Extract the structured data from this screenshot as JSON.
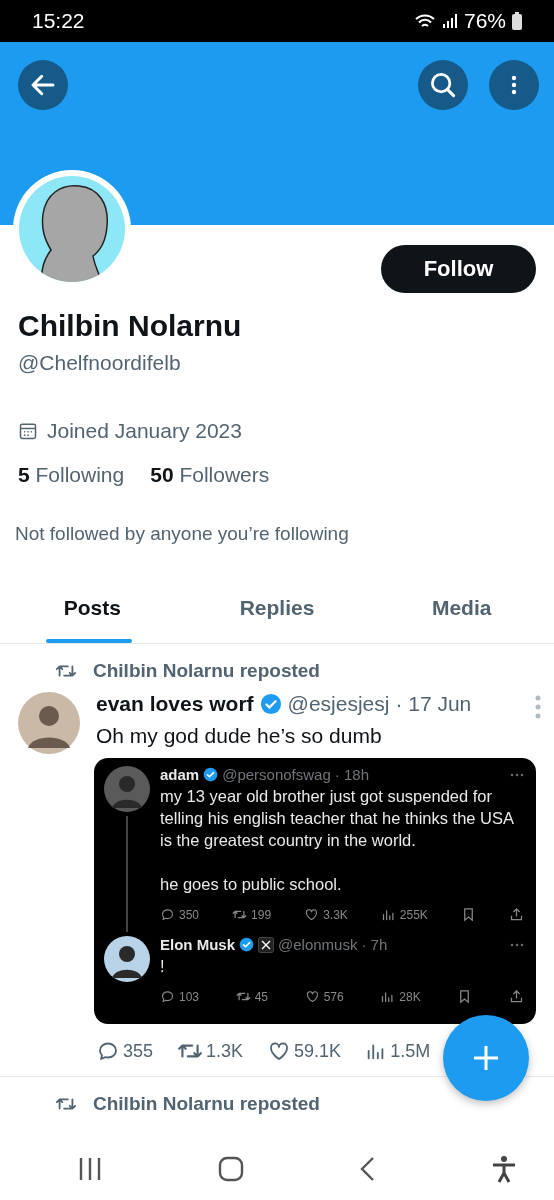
{
  "status_bar": {
    "time": "15:22",
    "battery": "76%"
  },
  "profile": {
    "name": "Chilbin Nolarnu",
    "handle": "@Chelfnoordifelb",
    "joined": "Joined January 2023",
    "following_count": "5",
    "following_label": "Following",
    "followers_count": "50",
    "followers_label": "Followers",
    "note": "Not followed by anyone you’re following",
    "follow_button": "Follow"
  },
  "tabs": [
    {
      "label": "Posts",
      "selected": true
    },
    {
      "label": "Replies",
      "selected": false
    },
    {
      "label": "Media",
      "selected": false
    }
  ],
  "feed": [
    {
      "repost_label": "Chilbin Nolarnu reposted",
      "author": "evan loves worf",
      "verified": true,
      "handle": "@esjesjesj",
      "date": "· 17 Jun",
      "text": "Oh my god dude he’s so dumb",
      "quoted": [
        {
          "author": "adam",
          "verified": true,
          "x_badge": false,
          "handle": "@personofswag",
          "time": "· 18h",
          "text": "my 13 year old brother just got suspended for telling his english teacher that he thinks the USA is the greatest country in the world.\n\nhe goes to public school.",
          "replies": "350",
          "reposts": "199",
          "likes": "3.3K",
          "views": "255K"
        },
        {
          "author": "Elon Musk",
          "verified": true,
          "x_badge": true,
          "handle": "@elonmusk",
          "time": "· 7h",
          "text": "!",
          "replies": "103",
          "reposts": "45",
          "likes": "576",
          "views": "28K"
        }
      ],
      "replies": "355",
      "reposts": "1.3K",
      "likes": "59.1K",
      "views": "1.5M"
    },
    {
      "repost_label": "Chilbin Nolarnu reposted"
    }
  ]
}
